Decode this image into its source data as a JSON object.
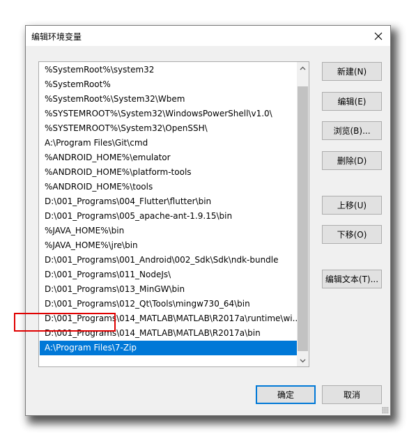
{
  "dialog": {
    "title": "编辑环境变量"
  },
  "list": {
    "items": [
      "%SystemRoot%\\system32",
      "%SystemRoot%",
      "%SystemRoot%\\System32\\Wbem",
      "%SYSTEMROOT%\\System32\\WindowsPowerShell\\v1.0\\",
      "%SYSTEMROOT%\\System32\\OpenSSH\\",
      "A:\\Program Files\\Git\\cmd",
      "%ANDROID_HOME%\\emulator",
      "%ANDROID_HOME%\\platform-tools",
      "%ANDROID_HOME%\\tools",
      "D:\\001_Programs\\004_Flutter\\flutter\\bin",
      "D:\\001_Programs\\005_apache-ant-1.9.15\\bin",
      "%JAVA_HOME%\\bin",
      "%JAVA_HOME%\\jre\\bin",
      "D:\\001_Programs\\001_Android\\002_Sdk\\Sdk\\ndk-bundle",
      "D:\\001_Programs\\011_NodeJs\\",
      "D:\\001_Programs\\013_MinGW\\bin",
      "D:\\001_Programs\\012_Qt\\Tools\\mingw730_64\\bin",
      "D:\\001_Programs\\014_MATLAB\\MATLAB\\R2017a\\runtime\\wi...",
      "D:\\001_Programs\\014_MATLAB\\MATLAB\\R2017a\\bin",
      "A:\\Program Files\\7-Zip"
    ],
    "selected_index": 19
  },
  "buttons": {
    "new": "新建(N)",
    "edit": "编辑(E)",
    "browse": "浏览(B)...",
    "delete": "删除(D)",
    "move_up": "上移(U)",
    "move_down": "下移(O)",
    "edit_text": "编辑文本(T)...",
    "ok": "确定",
    "cancel": "取消"
  },
  "colors": {
    "selection": "#0078d7",
    "highlight_box": "#e00000"
  }
}
